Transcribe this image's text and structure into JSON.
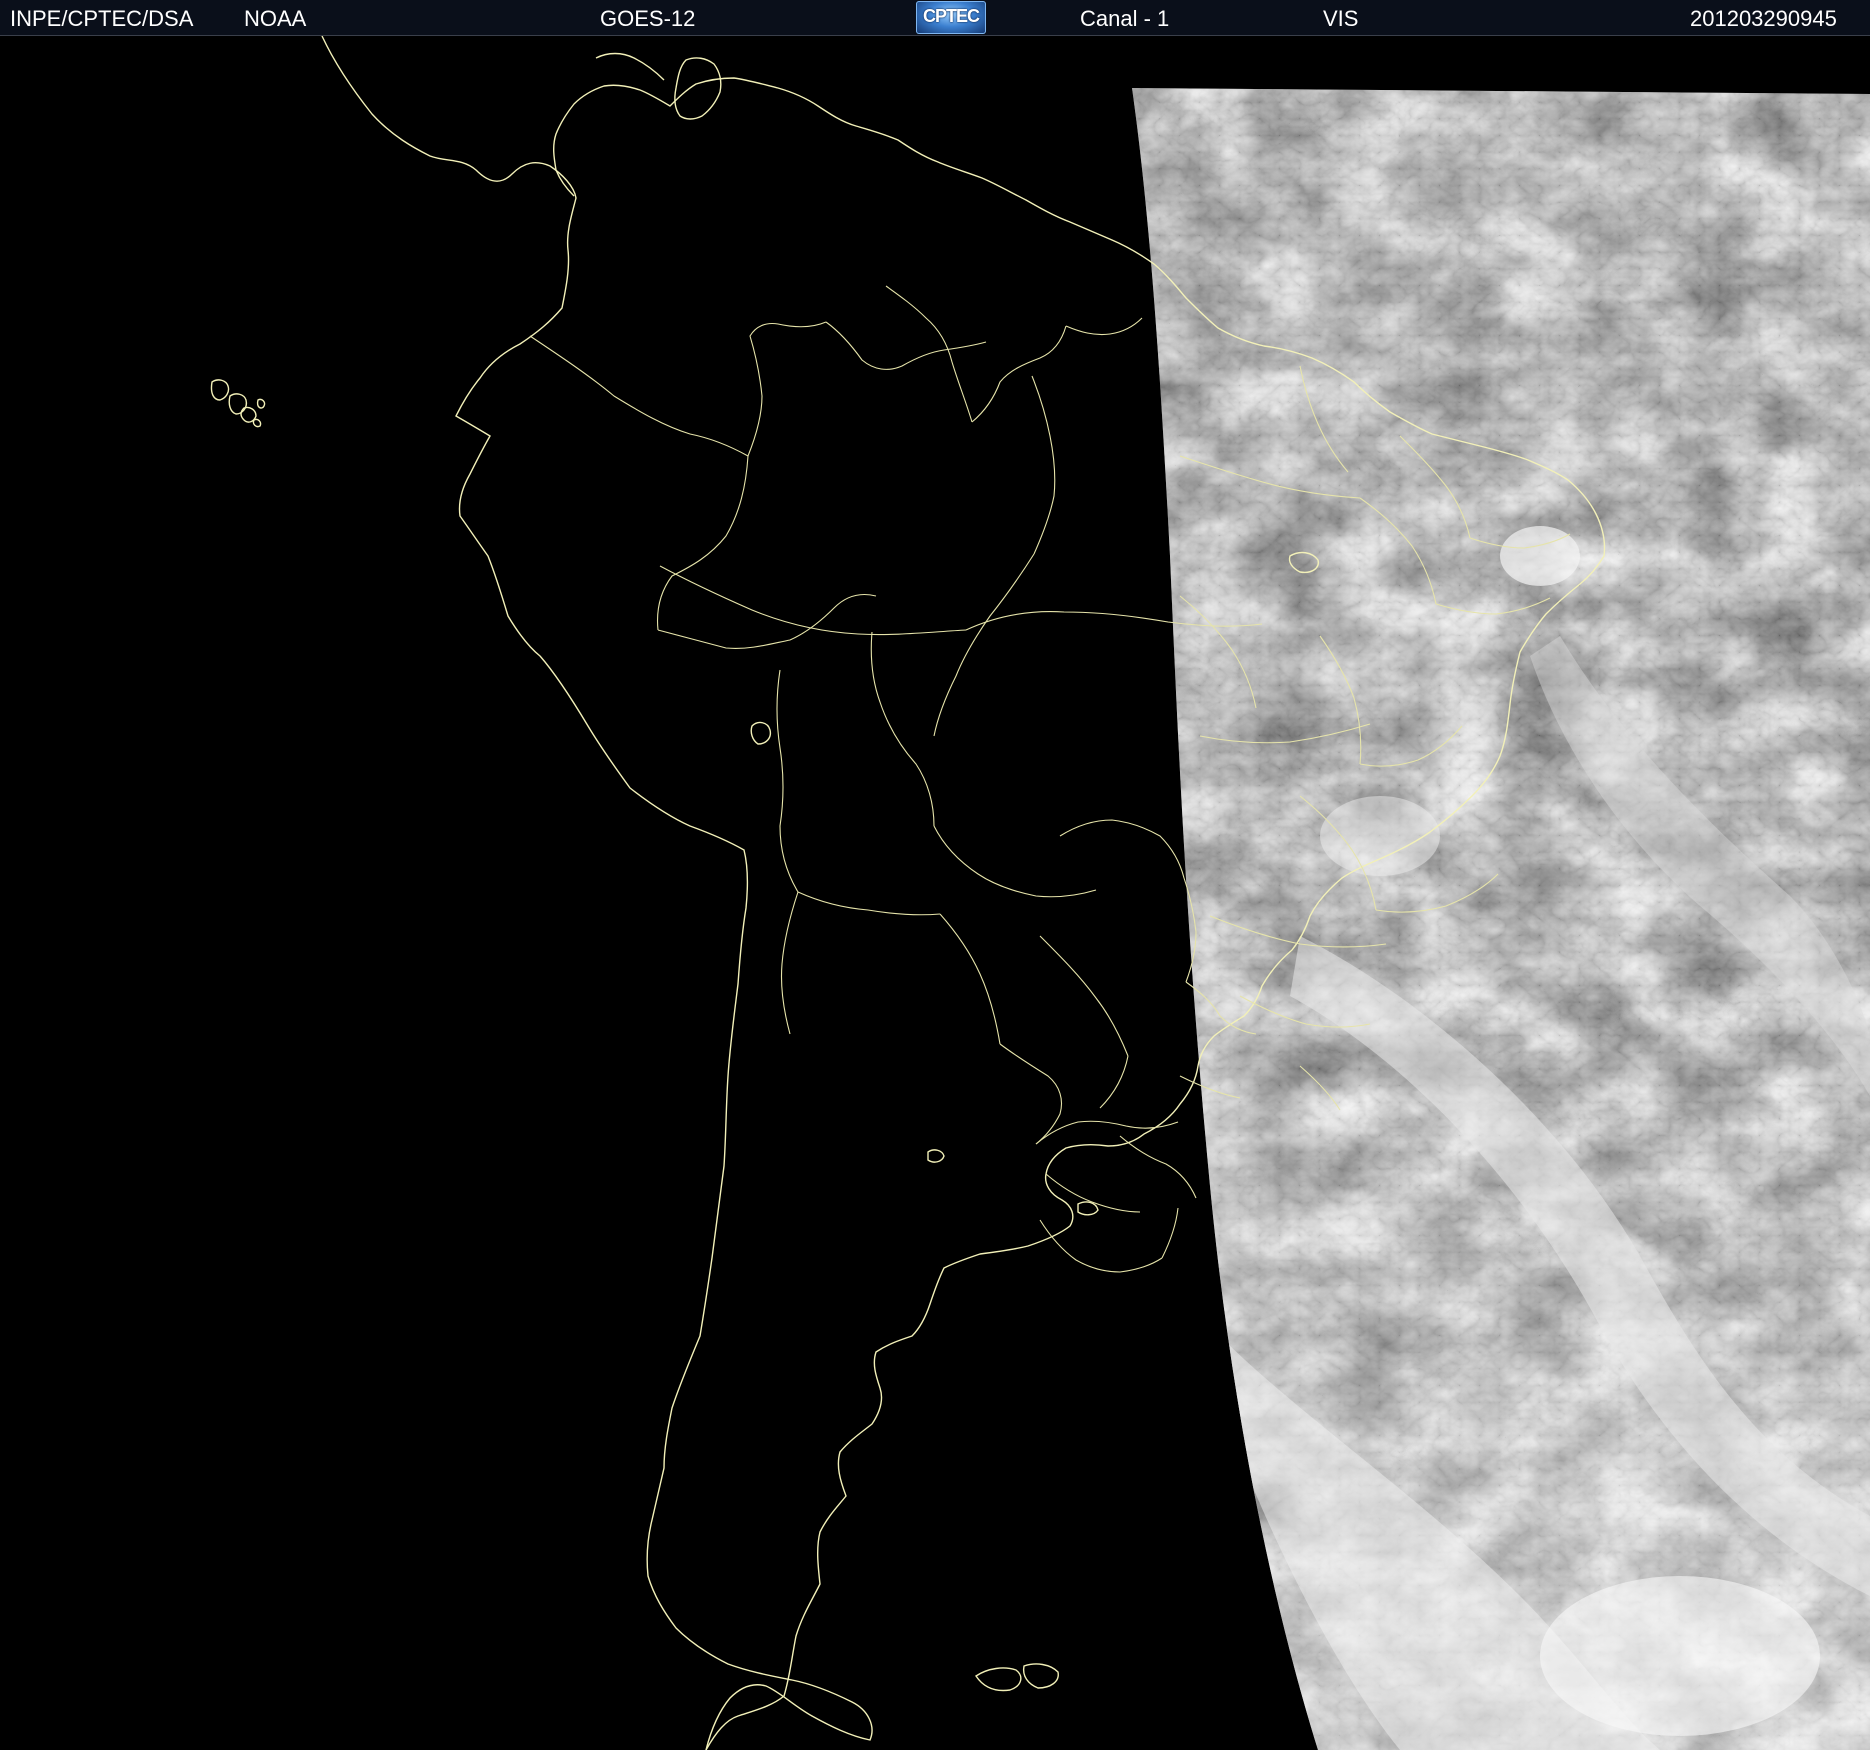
{
  "header": {
    "agency": "INPE/CPTEC/DSA",
    "source": "NOAA",
    "satellite": "GOES-12",
    "logo_text": "CPTEC",
    "channel": "Canal - 1",
    "band": "VIS",
    "timestamp": "201203290945"
  },
  "colors": {
    "background": "#000000",
    "header_bg": "#0a0f1a",
    "coastline": "#f2f0b8",
    "cloud_light": "#eeeeee",
    "ocean_gray": "#5a5a5a"
  },
  "icons": {
    "logo": "cptec-logo"
  }
}
